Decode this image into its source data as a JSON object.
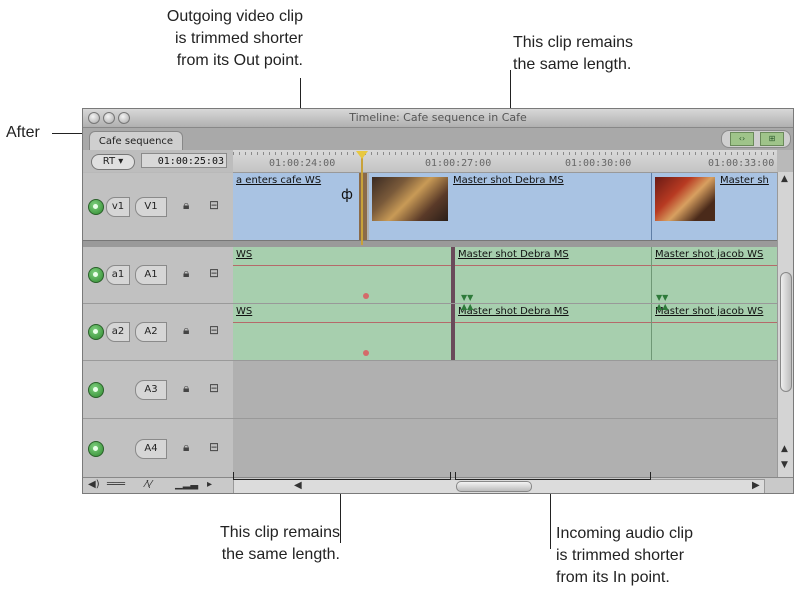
{
  "annotations": {
    "after": "After",
    "outgoing_video": "Outgoing video clip\nis trimmed shorter\nfrom its Out point.",
    "clip_remains_top": "This clip remains\nthe same length.",
    "clip_remains_bottom": "This clip remains\nthe same length.",
    "incoming_audio": "Incoming audio clip\nis trimmed shorter\nfrom its In point."
  },
  "window": {
    "title": "Timeline: Cafe sequence in Cafe",
    "tab_label": "Cafe sequence",
    "rt_label": "RT",
    "timecode": "01:00:25:03",
    "ruler_timecodes": [
      "01:00:24:00",
      "01:00:27:00",
      "01:00:30:00",
      "01:00:33:00"
    ]
  },
  "tracks": [
    {
      "src": "v1",
      "dst": "V1"
    },
    {
      "src": "a1",
      "dst": "A1"
    },
    {
      "src": "a2",
      "dst": "A2"
    },
    {
      "src": "",
      "dst": "A3"
    },
    {
      "src": "",
      "dst": "A4"
    }
  ],
  "clips": {
    "v1": [
      "a enters cafe WS",
      "Master shot Debra MS",
      "Master sh"
    ],
    "a1": [
      "WS",
      "Master shot Debra MS",
      "Master shot jacob WS"
    ],
    "a2": [
      "WS",
      "Master shot Debra MS",
      "Master shot jacob WS"
    ]
  },
  "colors": {
    "video_clip": "#a9c3e3",
    "audio_clip": "#a7cfae",
    "playhead": "#e8c840",
    "speaker_icon": "#2f8a2f"
  },
  "icons": {
    "lock": "lock-icon",
    "link": "link-icon",
    "speaker": "speaker-icon",
    "play_marker": "playhead-icon"
  }
}
